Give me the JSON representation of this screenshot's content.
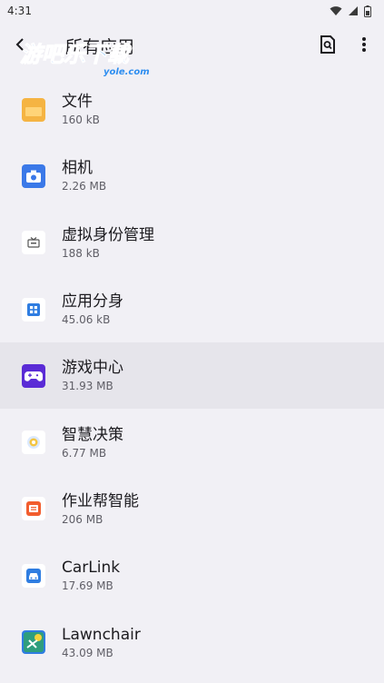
{
  "status_bar": {
    "time": "4:31",
    "icons": [
      "wifi-icon",
      "signal-icon",
      "battery-icon"
    ]
  },
  "app_bar": {
    "title": "所有应用",
    "watermark_text": "游吧乐下载",
    "watermark_sub": "yole.com",
    "icons": {
      "back": "back-arrow-icon",
      "search": "search-document-icon",
      "menu": "more-vertical-icon"
    }
  },
  "apps": [
    {
      "name": "文件",
      "size": "160 kB",
      "icon": "folder-icon",
      "color": "#f5b443"
    },
    {
      "name": "相机",
      "size": "2.26 MB",
      "icon": "camera-icon",
      "color": "#3b79e8"
    },
    {
      "name": "虚拟身份管理",
      "size": "188 kB",
      "icon": "tv-icon",
      "color": "#ffffff"
    },
    {
      "name": "应用分身",
      "size": "45.06 kB",
      "icon": "grid-icon",
      "color": "#ffffff"
    },
    {
      "name": "游戏中心",
      "size": "31.93 MB",
      "icon": "gamepad-icon",
      "color": "#5a2bd6",
      "selected": true
    },
    {
      "name": "智慧决策",
      "size": "6.77 MB",
      "icon": "decision-icon",
      "color": "#ffffff"
    },
    {
      "name": "作业帮智能",
      "size": "206 MB",
      "icon": "homework-icon",
      "color": "#ffffff"
    },
    {
      "name": "CarLink",
      "size": "17.69 MB",
      "icon": "car-icon",
      "color": "#ffffff"
    },
    {
      "name": "Lawnchair",
      "size": "43.09 MB",
      "icon": "lawnchair-icon",
      "color": "#2f7de1"
    }
  ]
}
